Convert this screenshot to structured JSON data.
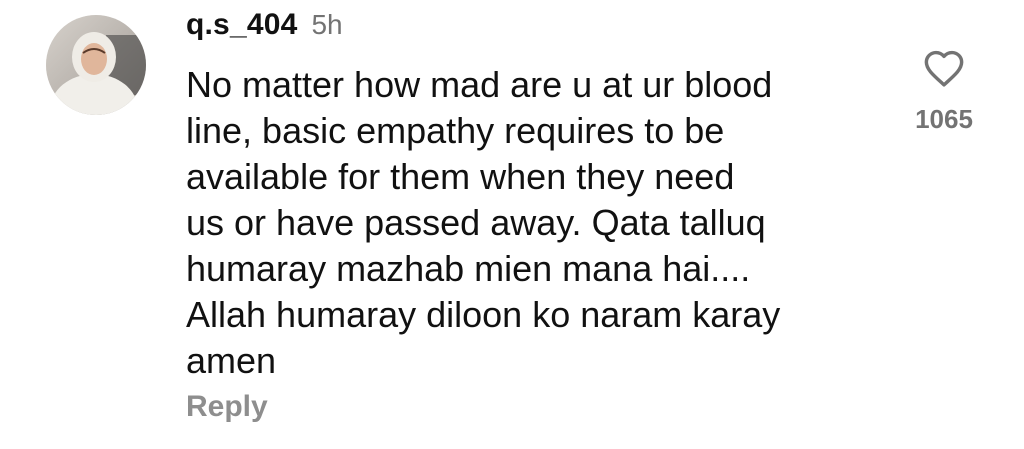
{
  "comment": {
    "username": "q.s_404",
    "time_ago": "5h",
    "text": "No matter how mad are u at ur blood\nline, basic empathy requires to be\navailable for them when they need\nus or have passed away. Qata talluq\nhumaray mazhab mien mana hai....\nAllah humaray diloon ko naram karay\namen",
    "reply_label": "Reply",
    "like_count": "1065",
    "like_icon": "heart-outline-icon"
  }
}
